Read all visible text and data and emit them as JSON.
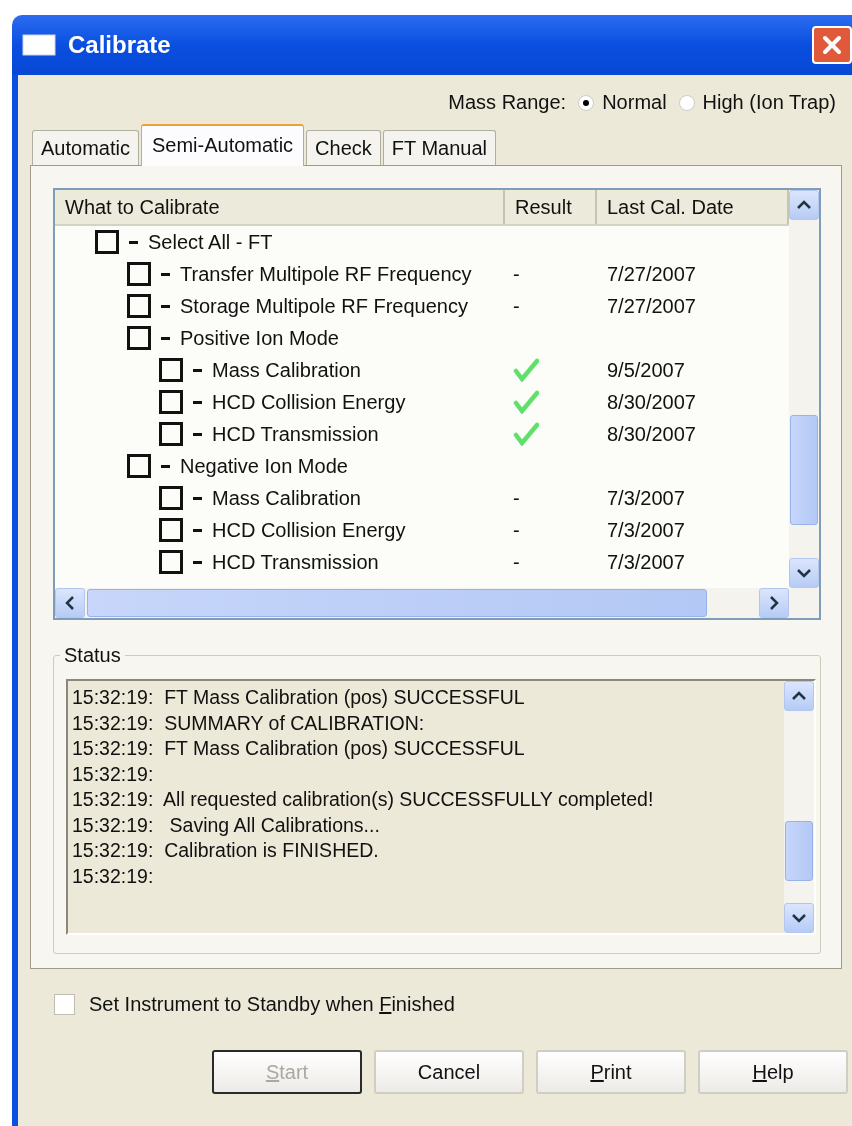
{
  "window": {
    "title": "Calibrate"
  },
  "mass_range": {
    "label": "Mass Range:",
    "options": [
      {
        "label": "Normal",
        "selected": true
      },
      {
        "label": "High (Ion Trap)",
        "selected": false
      }
    ]
  },
  "tabs": [
    {
      "label": "Automatic",
      "selected": false
    },
    {
      "label": "Semi-Automatic",
      "selected": true
    },
    {
      "label": "Check",
      "selected": false
    },
    {
      "label": "FT Manual",
      "selected": false
    }
  ],
  "table": {
    "columns": [
      "What to Calibrate",
      "Result",
      "Last Cal. Date"
    ],
    "tree": [
      {
        "label": "Select All - FT",
        "checked": false,
        "children": [
          {
            "label": "Transfer Multipole RF Frequency",
            "checked": false,
            "result": "-",
            "date": "7/27/2007"
          },
          {
            "label": "Storage Multipole RF Frequency",
            "checked": false,
            "result": "-",
            "date": "7/27/2007"
          },
          {
            "label": "Positive Ion Mode",
            "checked": false,
            "children": [
              {
                "label": "Mass Calibration",
                "checked": false,
                "passed": true,
                "date": "9/5/2007"
              },
              {
                "label": "HCD Collision Energy",
                "checked": false,
                "passed": true,
                "date": "8/30/2007"
              },
              {
                "label": "HCD Transmission",
                "checked": false,
                "passed": true,
                "date": "8/30/2007"
              }
            ]
          },
          {
            "label": "Negative Ion Mode",
            "checked": false,
            "children": [
              {
                "label": "Mass Calibration",
                "checked": false,
                "result": "-",
                "date": "7/3/2007"
              },
              {
                "label": "HCD Collision Energy",
                "checked": false,
                "result": "-",
                "date": "7/3/2007"
              },
              {
                "label": "HCD Transmission",
                "checked": false,
                "result": "-",
                "date": "7/3/2007"
              }
            ]
          }
        ]
      }
    ]
  },
  "status": {
    "title": "Status",
    "lines": [
      "15:32:19:  FT Mass Calibration (pos) SUCCESSFUL",
      "15:32:19:  SUMMARY of CALIBRATION:",
      "15:32:19:  FT Mass Calibration (pos) SUCCESSFUL",
      "15:32:19:",
      "15:32:19:  All requested calibration(s) SUCCESSFULLY completed!",
      "15:32:19:   Saving All Calibrations...",
      "15:32:19:  Calibration is FINISHED.",
      "15:32:19:"
    ]
  },
  "standby": {
    "label": "Set Instrument to Standby when ",
    "mnemonic": "F",
    "rest": "inished",
    "checked": false
  },
  "buttons": [
    {
      "mnemonic": "S",
      "rest": "tart",
      "disabled": true
    },
    {
      "label": "Cancel",
      "disabled": false
    },
    {
      "mnemonic": "P",
      "rest": "rint",
      "disabled": false
    },
    {
      "mnemonic": "H",
      "rest": "elp",
      "disabled": false
    }
  ]
}
